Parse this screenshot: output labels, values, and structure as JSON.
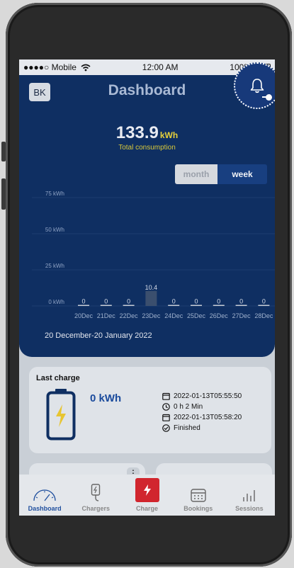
{
  "status_bar": {
    "carrier": "●●●●○ Mobile",
    "time": "12:00 AM",
    "battery": "100%"
  },
  "header": {
    "avatar_initials": "BK",
    "title": "Dashboard"
  },
  "summary": {
    "value": "133.9",
    "unit": "kWh",
    "label": "Total consumption"
  },
  "period_toggle": {
    "month_label": "month",
    "week_label": "week",
    "selected": "week"
  },
  "chart_data": {
    "type": "bar",
    "categories": [
      "20Dec",
      "21Dec",
      "22Dec",
      "23Dec",
      "24Dec",
      "25Dec",
      "26Dec",
      "27Dec",
      "28Dec"
    ],
    "values": [
      0,
      0,
      0,
      10.4,
      0,
      0,
      0,
      0,
      0
    ],
    "value_labels": [
      "0",
      "0",
      "0",
      "10.4",
      "0",
      "0",
      "0",
      "0",
      "0"
    ],
    "y_ticks": [
      "0 kWh",
      "25 kWh",
      "50 kWh",
      "75 kWh"
    ],
    "ylim": [
      0,
      75
    ],
    "grid": true
  },
  "date_range": "20 December-20 January 2022",
  "last_charge": {
    "title": "Last charge",
    "energy": "0 kWh",
    "start": "2022-01-13T05:55:50",
    "duration": "0 h 2 Min",
    "end": "2022-01-13T05:58:20",
    "status": "Finished"
  },
  "more_label": ":",
  "tabs": [
    {
      "label": "Dashboard",
      "icon": "speedometer-icon",
      "active": true
    },
    {
      "label": "Chargers",
      "icon": "charger-plug-icon",
      "active": false
    },
    {
      "label": "Charge",
      "icon": "lightning-icon",
      "active": false
    },
    {
      "label": "Bookings",
      "icon": "calendar-icon",
      "active": false
    },
    {
      "label": "Sessions",
      "icon": "bar-chart-icon",
      "active": false
    }
  ],
  "colors": {
    "primary": "#0f2f62",
    "accent": "#e7d13a",
    "charge": "#d1262e",
    "active_tab": "#1f4f9e"
  }
}
